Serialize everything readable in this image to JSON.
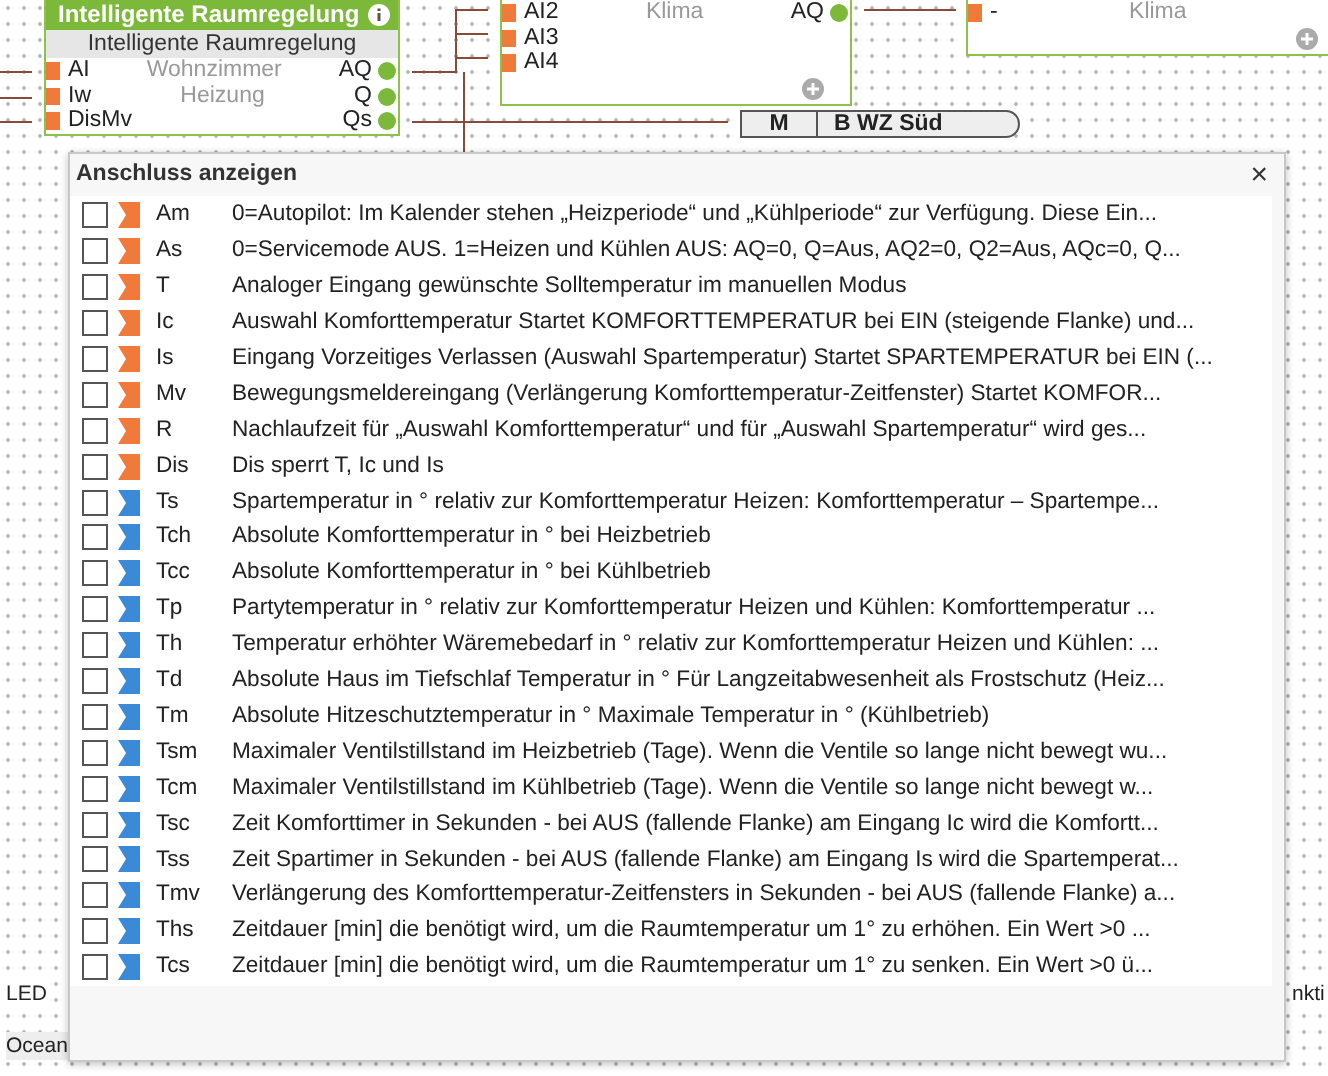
{
  "canvas": {
    "blocks": [
      {
        "title": "Intelligente Raumregelung",
        "subtitle": "Intelligente Raumregelung",
        "rows": [
          {
            "input": "AI",
            "label": "Wohnzimmer",
            "output": "AQ"
          },
          {
            "input": "Iw",
            "label": "Heizung",
            "output": "Q"
          },
          {
            "input": "DisMv",
            "output": "Qs"
          }
        ]
      },
      {
        "rows": [
          {
            "input": "AI2",
            "label": "Klima",
            "output": "AQ"
          },
          {
            "input": "AI3"
          },
          {
            "input": "AI4"
          }
        ]
      },
      {
        "rows": [
          {
            "input": "-",
            "label": "Klima"
          }
        ]
      }
    ],
    "tag_block": {
      "mode": "M",
      "name": "B WZ Süd"
    },
    "bottom_tags": [
      "LED",
      "Ocean",
      "nkti"
    ]
  },
  "dialog": {
    "title": "Anschluss anzeigen",
    "close": "×",
    "rows": [
      {
        "code": "Am",
        "kind": "binary",
        "checked": false,
        "text": "0=Autopilot: Im Kalender stehen „Heizperiode“ und „Kühlperiode“ zur Verfügung. Diese Ein..."
      },
      {
        "code": "As",
        "kind": "binary",
        "checked": false,
        "text": "0=Servicemode AUS. 1=Heizen und Kühlen AUS: AQ=0, Q=Aus, AQ2=0, Q2=Aus, AQc=0, Q..."
      },
      {
        "code": "T",
        "kind": "binary",
        "checked": false,
        "text": "Analoger Eingang gewünschte Solltemperatur im manuellen Modus"
      },
      {
        "code": "Ic",
        "kind": "binary",
        "checked": false,
        "text": "Auswahl Komforttemperatur Startet KOMFORTTEMPERATUR bei EIN (steigende Flanke) und..."
      },
      {
        "code": "Is",
        "kind": "binary",
        "checked": false,
        "text": "Eingang Vorzeitiges Verlassen (Auswahl Spartemperatur) Startet SPARTEMPERATUR bei EIN (..."
      },
      {
        "code": "Mv",
        "kind": "binary",
        "checked": false,
        "text": "Bewegungsmeldereingang (Verlängerung Komforttemperatur-Zeitfenster) Startet KOMFOR..."
      },
      {
        "code": "R",
        "kind": "binary",
        "checked": false,
        "text": "Nachlaufzeit für „Auswahl Komforttemperatur“ und für „Auswahl Spartemperatur“ wird ges..."
      },
      {
        "code": "Dis",
        "kind": "binary",
        "checked": false,
        "text": "Dis sperrt T, Ic und Is"
      },
      {
        "code": "Ts",
        "kind": "parameter",
        "checked": false,
        "text": "Spartemperatur in ° relativ zur Komforttemperatur Heizen: Komforttemperatur – Spartempe..."
      },
      {
        "code": "Tch",
        "kind": "parameter",
        "checked": false,
        "text": "Absolute Komforttemperatur in ° bei Heizbetrieb"
      },
      {
        "code": "Tcc",
        "kind": "parameter",
        "checked": false,
        "text": "Absolute Komforttemperatur in ° bei Kühlbetrieb"
      },
      {
        "code": "Tp",
        "kind": "parameter",
        "checked": false,
        "text": "Partytemperatur in ° relativ zur Komforttemperatur Heizen und Kühlen: Komforttemperatur ..."
      },
      {
        "code": "Th",
        "kind": "parameter",
        "checked": false,
        "text": "Temperatur erhöhter Wäremebedarf in ° relativ zur Komforttemperatur Heizen und Kühlen: ..."
      },
      {
        "code": "Td",
        "kind": "parameter",
        "checked": false,
        "text": "Absolute Haus im Tiefschlaf Temperatur in ° Für Langzeitabwesenheit als Frostschutz (Heiz..."
      },
      {
        "code": "Tm",
        "kind": "parameter",
        "checked": false,
        "text": "Absolute Hitzeschutztemperatur in ° Maximale Temperatur in ° (Kühlbetrieb)"
      },
      {
        "code": "Tsm",
        "kind": "parameter",
        "checked": false,
        "text": "Maximaler Ventilstillstand im Heizbetrieb (Tage). Wenn die Ventile so lange nicht bewegt wu..."
      },
      {
        "code": "Tcm",
        "kind": "parameter",
        "checked": false,
        "text": "Maximaler Ventilstillstand im Kühlbetrieb (Tage). Wenn die Ventile so lange nicht bewegt w..."
      },
      {
        "code": "Tsc",
        "kind": "parameter",
        "checked": false,
        "text": "Zeit Komforttimer in Sekunden - bei AUS (fallende Flanke) am Eingang Ic wird die Komfortt..."
      },
      {
        "code": "Tss",
        "kind": "parameter",
        "checked": false,
        "text": "Zeit Spartimer in Sekunden - bei AUS (fallende Flanke) am Eingang Is wird die Spartemperat..."
      },
      {
        "code": "Tmv",
        "kind": "parameter",
        "checked": false,
        "text": "Verlängerung des Komforttemperatur-Zeitfensters in Sekunden - bei AUS (fallende Flanke) a..."
      },
      {
        "code": "Ths",
        "kind": "parameter",
        "checked": false,
        "text": "Zeitdauer [min] die benötigt wird, um die Raumtemperatur um 1° zu erhöhen. Ein Wert >0 ..."
      },
      {
        "code": "Tcs",
        "kind": "parameter",
        "checked": false,
        "text": "Zeitdauer [min] die benötigt wird, um die Raumtemperatur um 1° zu senken. Ein Wert >0 ü..."
      }
    ]
  }
}
